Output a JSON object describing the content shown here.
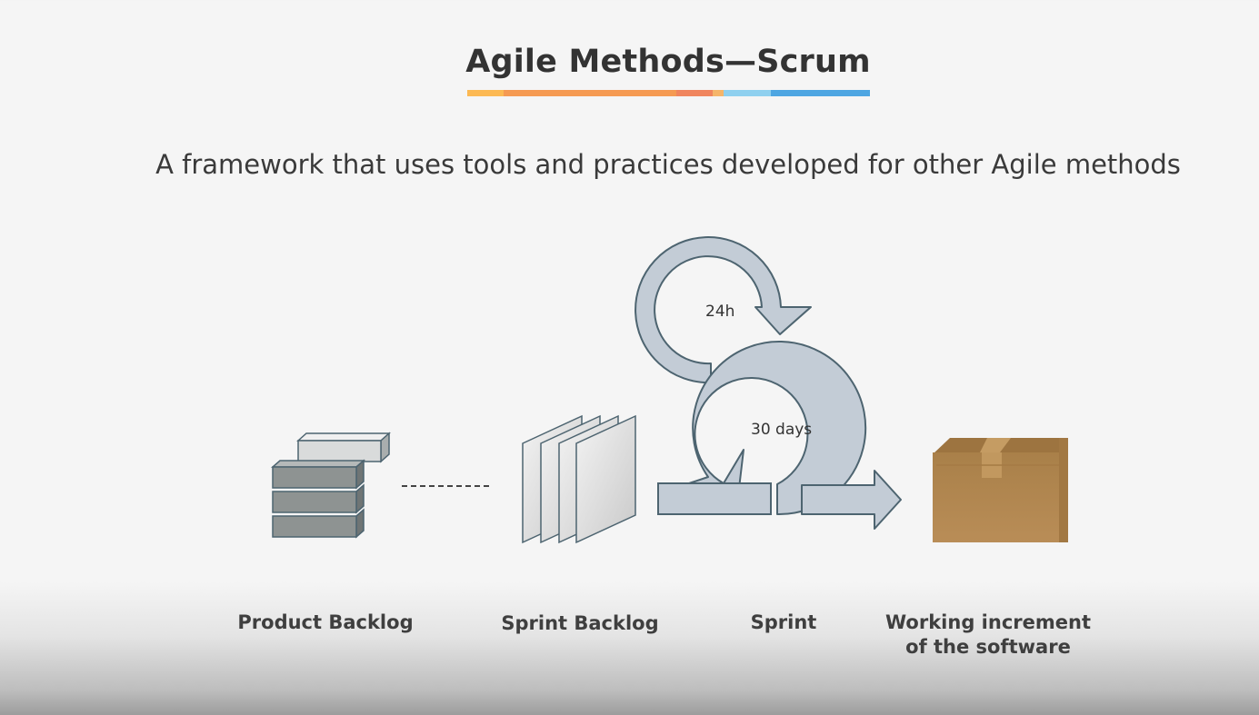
{
  "slide": {
    "title": "Agile Methods—Scrum",
    "subtitle": "A framework that uses tools and practices developed for other Agile methods",
    "underline_colors": [
      "#fcb953",
      "#f59a52",
      "#f0855e",
      "#8fd0ef",
      "#4ea6e2"
    ]
  },
  "diagram": {
    "loop_small_label": "24h",
    "loop_large_label": "30 days",
    "stages": [
      {
        "label": "Product Backlog"
      },
      {
        "label": "Sprint Backlog"
      },
      {
        "label": "Sprint"
      },
      {
        "label_line1": "Working increment",
        "label_line2": "of the software"
      }
    ],
    "colors": {
      "arrow_fill": "#c3ccd6",
      "outline": "#4d6470",
      "block_fill": "#8e9392",
      "box_fill": "#b38650"
    }
  }
}
